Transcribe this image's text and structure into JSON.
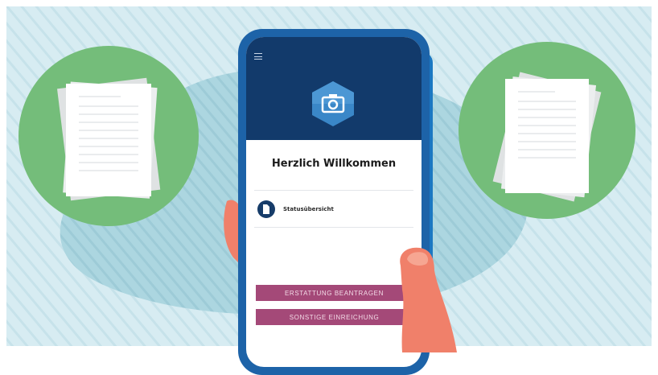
{
  "app": {
    "welcome_title": "Herzlich Willkommen",
    "menu_icon": "hamburger-menu-icon",
    "logo_icon": "camera-icon"
  },
  "status_item": {
    "label": "Statusübersicht",
    "icon": "document-icon"
  },
  "actions": {
    "primary_label": "ERSTATTUNG BEANTRAGEN",
    "secondary_label": "SONSTIGE EINREICHUNG"
  },
  "colors": {
    "background": "#d7ecf2",
    "blob": "#acd6e0",
    "circle_green": "#74bd7a",
    "phone_frame": "#1d63a8",
    "app_header": "#123a6b",
    "logo_hex": "#3a87c8",
    "button": "#a44978",
    "skin": "#f0806a"
  }
}
